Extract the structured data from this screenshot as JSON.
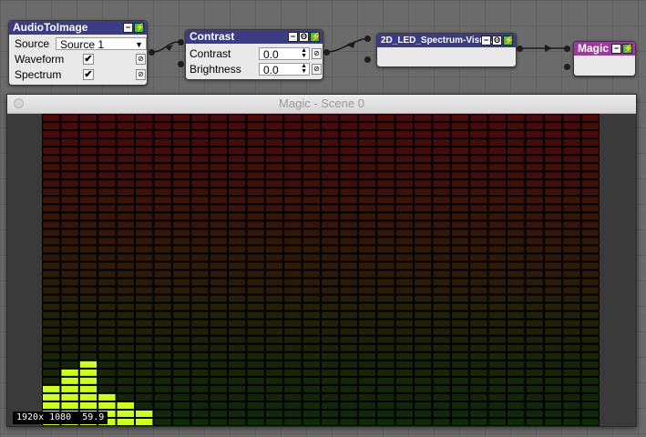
{
  "nodes": {
    "audio": {
      "title": "AudioToImage",
      "source_label": "Source",
      "source_value": "Source 1",
      "waveform_label": "Waveform",
      "waveform_checked": "✔",
      "spectrum_label": "Spectrum",
      "spectrum_checked": "✔"
    },
    "contrast": {
      "title": "Contrast",
      "contrast_label": "Contrast",
      "contrast_value": "0.0",
      "brightness_label": "Brightness",
      "brightness_value": "0.0"
    },
    "led": {
      "title": "2D_LED_Spectrum-Visu..."
    },
    "magic": {
      "title": "Magic"
    },
    "btn_minus": "−",
    "btn_eye": "ʘ",
    "btn_power": "⚡",
    "btn_link": "⊘"
  },
  "window": {
    "title": "Magic - Scene 0",
    "status_resolution": "1920x 1080",
    "status_fps": "59.9"
  },
  "visual": {
    "columns": 30,
    "rows": 38,
    "lit_cells": [
      5,
      7,
      8,
      4,
      3,
      2,
      0,
      0,
      0,
      0,
      0,
      0,
      0,
      0,
      0,
      0,
      0,
      0,
      0,
      0,
      0,
      0,
      0,
      0,
      0,
      0,
      0,
      0,
      0,
      0
    ],
    "lit_color": "#ccff22",
    "top_color": "#4a0a0a",
    "bottom_color": "#0e2a08"
  },
  "colors": {
    "node_header": "#3c3c84",
    "magic_header": "#9a3c9a",
    "power_green": "#46c146"
  }
}
